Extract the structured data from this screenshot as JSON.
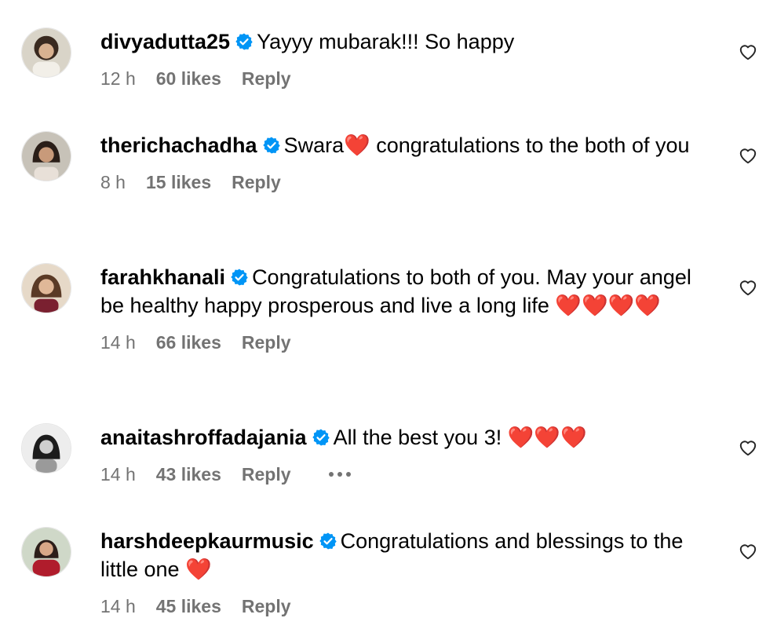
{
  "comments": [
    {
      "username": "divyadutta25",
      "text": "Yayyy mubarak!!! So happy",
      "hearts": "",
      "time": "12 h",
      "likes": "60 likes",
      "reply": "Reply",
      "more": false
    },
    {
      "username": "therichachadha",
      "text": "Swara",
      "hearts": "❤️",
      "text2": " congratulations to the both of you",
      "time": "8 h",
      "likes": "15 likes",
      "reply": "Reply",
      "more": false
    },
    {
      "username": "farahkhanali",
      "text": "Congratulations to both of you. May your angel be healthy happy prosperous and live a long life ",
      "hearts": "❤️❤️❤️❤️",
      "time": "14 h",
      "likes": "66 likes",
      "reply": "Reply",
      "more": false
    },
    {
      "username": "anaitashroffadajania",
      "text": "All the best you 3! ",
      "hearts": "❤️❤️❤️",
      "time": "14 h",
      "likes": "43 likes",
      "reply": "Reply",
      "more": true
    },
    {
      "username": "harshdeepkaurmusic",
      "text": "Congratulations and blessings to the little one ",
      "hearts": "❤️",
      "time": "14 h",
      "likes": "45 likes",
      "reply": "Reply",
      "more": false
    }
  ],
  "icons": {
    "verified": "verified-badge-icon",
    "like": "heart-outline-icon",
    "more": "more-horizontal-icon"
  },
  "colors": {
    "verified_blue": "#0095f6",
    "meta_gray": "#737373",
    "heart_red": "#e0191f"
  }
}
